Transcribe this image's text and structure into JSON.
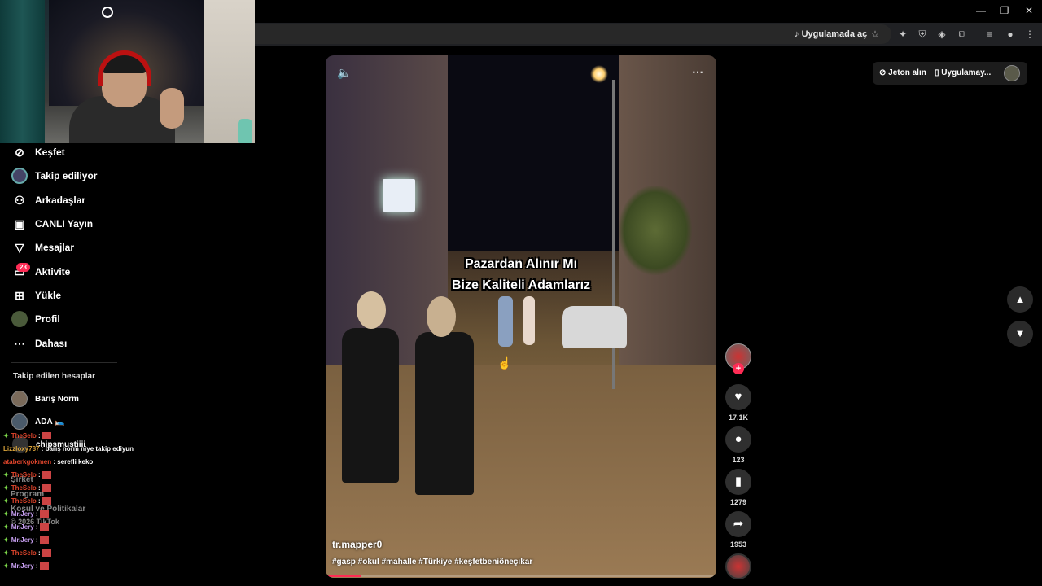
{
  "browser": {
    "open_in_app_label": "Uygulamada aç",
    "window_controls": {
      "minimize": "—",
      "restore": "❐",
      "close": "✕"
    }
  },
  "webcam": {
    "label": ""
  },
  "sidebar": {
    "items": [
      {
        "label": "Keşfet",
        "icon": "compass-icon"
      },
      {
        "label": "Takip ediliyor",
        "icon": "following-avatar"
      },
      {
        "label": "Arkadaşlar",
        "icon": "friends-icon"
      },
      {
        "label": "CANLI Yayın",
        "icon": "live-icon"
      },
      {
        "label": "Mesajlar",
        "icon": "message-icon"
      },
      {
        "label": "Aktivite",
        "icon": "activity-icon",
        "badge": "23"
      },
      {
        "label": "Yükle",
        "icon": "upload-icon"
      },
      {
        "label": "Profil",
        "icon": "profile-avatar"
      },
      {
        "label": "Dahası",
        "icon": "more-icon"
      }
    ],
    "following_title": "Takip edilen hesaplar",
    "accounts": [
      {
        "name": "Barış Norm"
      },
      {
        "name": "ADA 🛌"
      },
      {
        "name": "chipsmustiiii"
      }
    ],
    "footer": [
      "Şirket",
      "Program",
      "Koşul ve Politikalar",
      "© 2026 TikTok"
    ]
  },
  "chat": [
    {
      "user": "TheSelo",
      "color": "#e0452c",
      "text": " :",
      "emote": true
    },
    {
      "user": "Lizzloxy787",
      "color": "#d9a33a",
      "text": " : barış norm niye takip ediyun",
      "emote": false
    },
    {
      "user": "ataberkgokmen",
      "color": "#e0452c",
      "text": " : serefli keko",
      "emote": false
    },
    {
      "user": "TheSelo",
      "color": "#e0452c",
      "text": " :",
      "emote": true
    },
    {
      "user": "TheSelo",
      "color": "#e0452c",
      "text": " :",
      "emote": true
    },
    {
      "user": "TheSelo",
      "color": "#e0452c",
      "text": " :",
      "emote": true
    },
    {
      "user": "Mr.Jery",
      "color": "#c69ef0",
      "text": " :",
      "emote": true
    },
    {
      "user": "Mr.Jery",
      "color": "#c69ef0",
      "text": " :",
      "emote": true
    },
    {
      "user": "Mr.Jery",
      "color": "#c69ef0",
      "text": " :",
      "emote": true
    },
    {
      "user": "TheSelo",
      "color": "#e0452c",
      "text": " :",
      "emote": true
    },
    {
      "user": "Mr.Jery",
      "color": "#c69ef0",
      "text": " :",
      "emote": true
    }
  ],
  "video": {
    "caption_line1": "Pazardan Alınır Mı",
    "caption_line2": "Bize Kaliteli Adamlarız",
    "author": "tr.mapper0",
    "tags": "#gasp #okul #mahalle #Türkiye #keşfetbeniöneçıkar",
    "progress": 0.09,
    "mute_icon": "volume-icon",
    "more_icon": "more-dots-icon"
  },
  "actions": {
    "likes": "17.1K",
    "comments": "123",
    "saves": "1279",
    "shares": "1953"
  },
  "topright": {
    "coins_label": "Jeton alın",
    "app_label": "Uygulamay..."
  },
  "colors": {
    "accent": "#fe2c55",
    "background": "#000000"
  }
}
